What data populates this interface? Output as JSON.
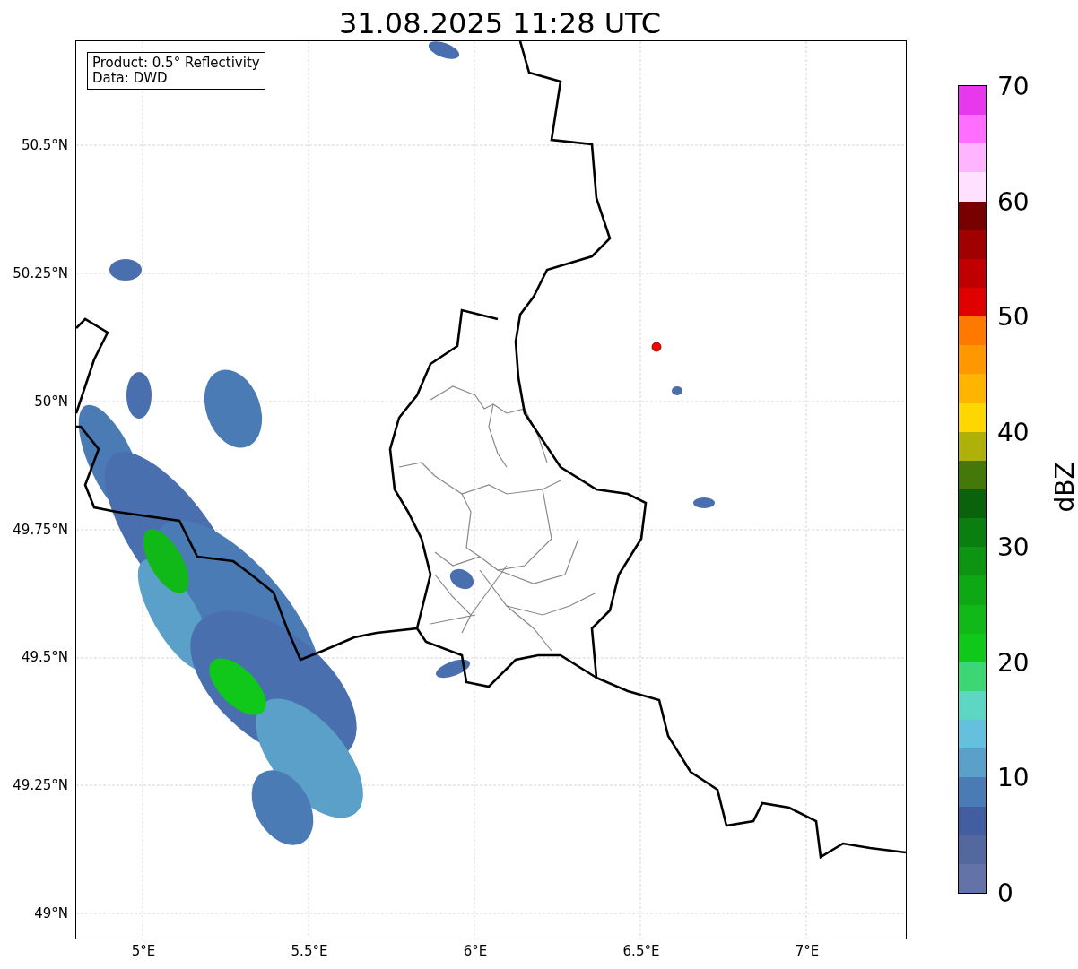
{
  "title": "31.08.2025 11:28 UTC",
  "info_box": [
    "Product: 0.5° Reflectivity",
    "Data: DWD"
  ],
  "map": {
    "yticks": [
      "50.5°N",
      "50.25°N",
      "50°N",
      "49.75°N",
      "49.5°N",
      "49.25°N",
      "49°N"
    ],
    "xticks": [
      "5°E",
      "5.5°E",
      "6°E",
      "6.5°E",
      "7°E"
    ]
  },
  "colorbar": {
    "ticks": [
      "70",
      "60",
      "50",
      "40",
      "30",
      "20",
      "10",
      "0"
    ],
    "label": "dBZ",
    "segments": [
      {
        "color": "#e838ee"
      },
      {
        "color": "#ff6eff"
      },
      {
        "color": "#ffb4ff"
      },
      {
        "color": "#ffe0ff"
      },
      {
        "color": "#780000"
      },
      {
        "color": "#a00000"
      },
      {
        "color": "#c00000"
      },
      {
        "color": "#e00000"
      },
      {
        "color": "#ff7800"
      },
      {
        "color": "#ff9800"
      },
      {
        "color": "#ffb400"
      },
      {
        "color": "#ffd700"
      },
      {
        "color": "#b0b00a"
      },
      {
        "color": "#44780a"
      },
      {
        "color": "#0a620c"
      },
      {
        "color": "#0b7e10"
      },
      {
        "color": "#0c9412"
      },
      {
        "color": "#0ea814"
      },
      {
        "color": "#10b818"
      },
      {
        "color": "#10c81a"
      },
      {
        "color": "#3cd674"
      },
      {
        "color": "#5ed6c4"
      },
      {
        "color": "#64c0dc"
      },
      {
        "color": "#5aa0c8"
      },
      {
        "color": "#4a7bb5"
      },
      {
        "color": "#425ea1"
      },
      {
        "color": "#53689f"
      },
      {
        "color": "#6373a7"
      }
    ]
  }
}
